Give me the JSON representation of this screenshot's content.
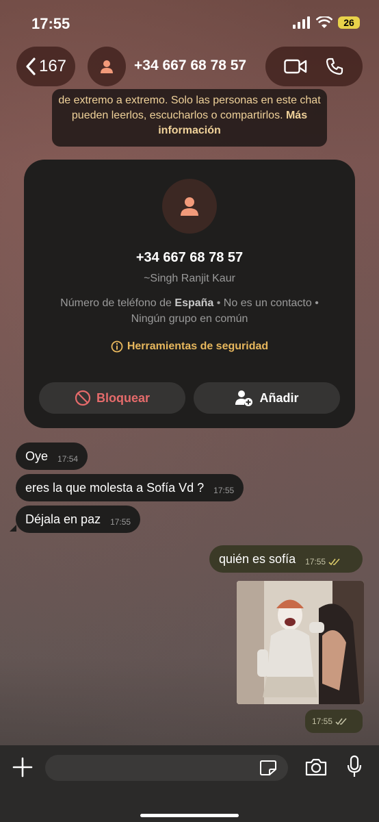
{
  "status_bar": {
    "time": "17:55",
    "battery": "26"
  },
  "header": {
    "back_count": "167",
    "title": "+34 667 68 78 57"
  },
  "encryption_notice": {
    "text": "de extremo a extremo. Solo las personas en este chat pueden leerlos, escucharlos o compartirlos.",
    "more_link": "Más información"
  },
  "contact_card": {
    "phone": "+34 667 68 78 57",
    "name": "~Singh Ranjit Kaur",
    "info_line1_prefix": "Número de teléfono de ",
    "info_country": "España",
    "info_line1_suffix": " • No es un contacto •",
    "info_line2": "Ningún grupo en común",
    "safety_tools": "Herramientas de seguridad",
    "block_label": "Bloquear",
    "add_label": "Añadir"
  },
  "messages": [
    {
      "direction": "in",
      "text": "Oye",
      "time": "17:54"
    },
    {
      "direction": "in",
      "text": "eres la que molesta a Sofía Vd ?",
      "time": "17:55"
    },
    {
      "direction": "in",
      "text": "Déjala en paz",
      "time": "17:55"
    },
    {
      "direction": "out",
      "text": "quién es sofía",
      "time": "17:55"
    },
    {
      "direction": "out",
      "type": "image",
      "time": "17:55"
    }
  ],
  "colors": {
    "incoming_bubble": "#1f1e1d",
    "outgoing_bubble": "#3b3a27",
    "read_ticks": "#d9c96a",
    "block_red": "#e56b6b",
    "safety_gold": "#e7b75d",
    "avatar_orange": "#f29a7a"
  },
  "icons": {
    "back": "chevron-left-icon",
    "video": "video-camera-icon",
    "call": "phone-icon",
    "plus": "plus-icon",
    "sticker": "sticker-icon",
    "camera": "camera-icon",
    "mic": "microphone-icon"
  }
}
